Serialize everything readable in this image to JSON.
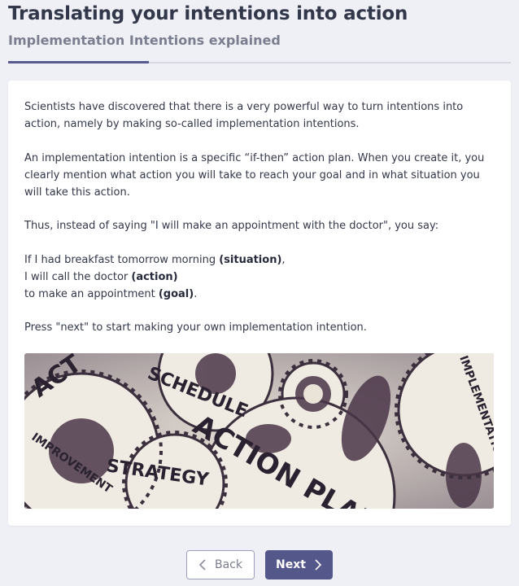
{
  "header": {
    "title": "Translating your intentions into action",
    "subtitle": "Implementation Intentions explained",
    "progress": 0.28
  },
  "content": {
    "p1": "Scientists have discovered that there is a very powerful way to turn intentions into action, namely by making so-called implementation intentions.",
    "p2": "An implementation intention is a specific “if-then” action plan. When you create it, you clearly mention what action you will take to reach your goal and in what situation you will take this action.",
    "p3": "Thus, instead of saying \"I will make an appointment with the doctor\", you say:",
    "example": {
      "line1": "If I had breakfast tomorrow morning ",
      "line1_tag": "(situation)",
      "line1_end": ",",
      "line2": "I will call the doctor ",
      "line2_tag": "(action)",
      "line3": "to make an appointment ",
      "line3_tag": "(goal)",
      "line3_end": "."
    },
    "p5": "Press \"next\" to start making your own implementation intention.",
    "image": {
      "words": [
        "ACT",
        "SCHEDULE",
        "IMPLEMENTATION",
        "IMPROVEMENT",
        "STRATEGY",
        "ACTION PLAN"
      ]
    }
  },
  "footer": {
    "back_label": "Back",
    "next_label": "Next"
  },
  "colors": {
    "accent": "#535789",
    "page_bg": "#eef0f5",
    "card_bg": "#ffffff"
  }
}
